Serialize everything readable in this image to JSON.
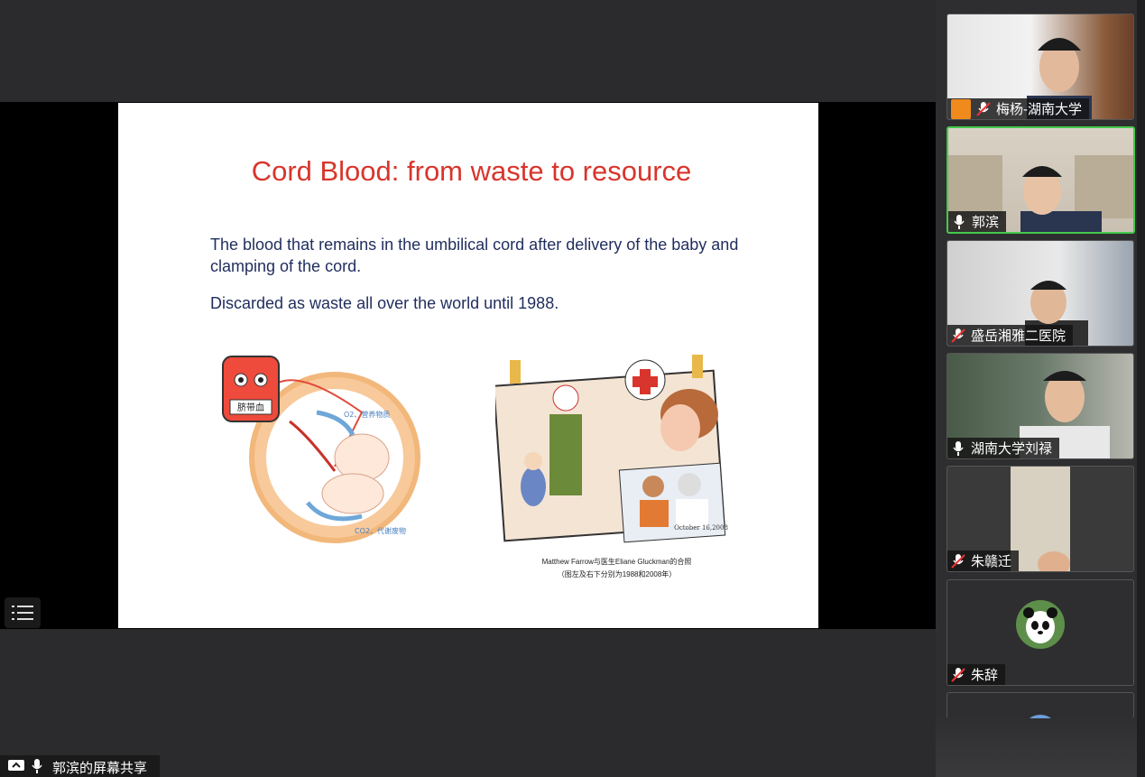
{
  "slide": {
    "title": "Cord Blood: from waste to resource",
    "bullet1": "The blood that remains in the umbilical cord after delivery of the baby and clamping of the cord.",
    "bullet2": "Discarded as waste all over the world until 1988.",
    "illus_left": {
      "bag_label": "脐带血",
      "arrow_top": "O2、营养物质",
      "arrow_bottom": "CO2、代谢废物"
    },
    "illus_right": {
      "photo_date": "October 16,2008"
    },
    "caption_line1": "Matthew Farrow与医生Eliane Gluckman的合照",
    "caption_line2": "（图左及右下分别为1988和2008年）"
  },
  "share_label": "郭滨的屏幕共享",
  "participants": [
    {
      "name": "梅杨-湖南大学",
      "muted": true
    },
    {
      "name": "郭滨",
      "muted": false
    },
    {
      "name": "盛岳湘雅二医院",
      "muted": true
    },
    {
      "name": "湖南大学刘禄",
      "muted": false
    },
    {
      "name": "朱赣迁",
      "muted": true
    },
    {
      "name": "朱辞",
      "muted": true
    }
  ],
  "colors": {
    "title": "#d8352c",
    "body": "#1f2d5e",
    "active_speaker": "#44c94c"
  }
}
